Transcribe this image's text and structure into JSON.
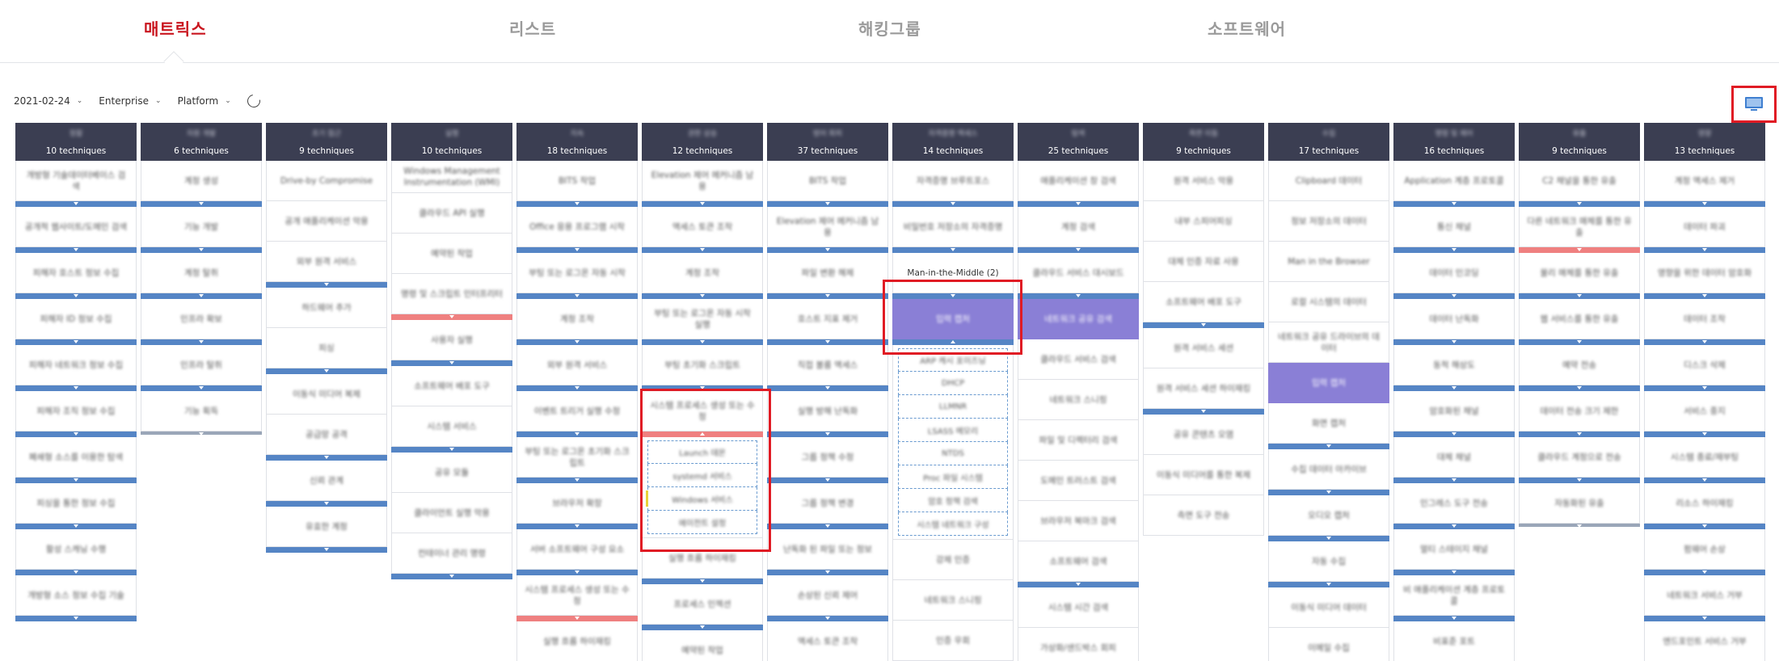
{
  "nav": {
    "tabs": [
      {
        "label": "매트릭스",
        "active": true
      },
      {
        "label": "리스트",
        "active": false
      },
      {
        "label": "해킹그룹",
        "active": false
      },
      {
        "label": "소프트웨어",
        "active": false
      }
    ]
  },
  "filters": {
    "date": "2021-02-24",
    "domain": "Enterprise",
    "platform": "Platform"
  },
  "colors": {
    "accent": "#c9151e",
    "header": "#3b3e52",
    "bar": "#5585c5",
    "bar_red": "#ef8080",
    "selected": "#8a7fd6",
    "highlight": "#e01b24"
  },
  "icons": {
    "view_toggle": "monitor-icon",
    "refresh": "refresh-icon",
    "chevron": "chevron-down-icon"
  },
  "columns": [
    {
      "tactic": "정찰",
      "count": "10 techniques",
      "cells": [
        {
          "t": "개방형 기술데이터베이스 검색",
          "bar": "blue"
        },
        {
          "t": "공개적 웹사이트/도메인 검색",
          "bar": "blue"
        },
        {
          "t": "피해자 호스트 정보 수집",
          "bar": "blue"
        },
        {
          "t": "피해자 ID 정보 수집",
          "bar": "blue"
        },
        {
          "t": "피해자 네트워크 정보 수집",
          "bar": "blue"
        },
        {
          "t": "피해자 조직 정보 수집",
          "bar": "blue"
        },
        {
          "t": "폐쇄형 소스를 이용한 탐색",
          "bar": "blue"
        },
        {
          "t": "피싱을 통한 정보 수집",
          "bar": "blue"
        },
        {
          "t": "활성 스캐닝 수행",
          "bar": "blue"
        },
        {
          "t": "개방형 소스 정보 수집 기술",
          "bar": "blue"
        }
      ]
    },
    {
      "tactic": "자원 개발",
      "count": "6 techniques",
      "cells": [
        {
          "t": "계정 생성",
          "bar": "blue"
        },
        {
          "t": "기능 개발",
          "bar": "blue"
        },
        {
          "t": "계정 탈취",
          "bar": "blue"
        },
        {
          "t": "인프라 확보",
          "bar": "blue"
        },
        {
          "t": "인프라 탈취",
          "bar": "blue"
        },
        {
          "t": "기능 획득",
          "bar": "gray"
        }
      ]
    },
    {
      "tactic": "초기 접근",
      "count": "9 techniques",
      "cells": [
        {
          "t": "Drive-by Compromise",
          "bar": "none"
        },
        {
          "t": "공개 애플리케이션 악용",
          "bar": "none"
        },
        {
          "t": "외부 원격 서비스",
          "bar": "blue"
        },
        {
          "t": "하드웨어 추가",
          "bar": "none"
        },
        {
          "t": "피싱",
          "bar": "blue"
        },
        {
          "t": "이동식 미디어 복제",
          "bar": "none"
        },
        {
          "t": "공급망 공격",
          "bar": "blue"
        },
        {
          "t": "신뢰 관계",
          "bar": "blue"
        },
        {
          "t": "유효한 계정",
          "bar": "blue"
        }
      ]
    },
    {
      "tactic": "실행",
      "count": "10 techniques",
      "cells": [
        {
          "t": "Windows Management Instrumentation (WMI)",
          "bar": "none"
        },
        {
          "t": "클라우드 API 실행",
          "bar": "none"
        },
        {
          "t": "예약된 작업",
          "bar": "none"
        },
        {
          "t": "명령 및 스크립트 인터프리터",
          "bar": "red"
        },
        {
          "t": "사용자 실행",
          "bar": "blue"
        },
        {
          "t": "소프트웨어 배포 도구",
          "bar": "none"
        },
        {
          "t": "시스템 서비스",
          "bar": "blue"
        },
        {
          "t": "공유 모듈",
          "bar": "none"
        },
        {
          "t": "클라이언트 실행 악용",
          "bar": "none"
        },
        {
          "t": "컨테이너 관리 명령",
          "bar": "blue"
        }
      ]
    },
    {
      "tactic": "지속",
      "count": "18 techniques",
      "cells": [
        {
          "t": "BITS 작업",
          "bar": "blue"
        },
        {
          "t": "Office 응용 프로그램 시작",
          "bar": "blue"
        },
        {
          "t": "부팅 또는 로그온 자동 시작",
          "bar": "blue"
        },
        {
          "t": "계정 조작",
          "bar": "blue"
        },
        {
          "t": "외부 원격 서비스",
          "bar": "blue"
        },
        {
          "t": "이벤트 트리거 실행 수정",
          "bar": "blue"
        },
        {
          "t": "부팅 또는 로그온 초기화 스크립트",
          "bar": "blue"
        },
        {
          "t": "브라우저 확장",
          "bar": "blue"
        },
        {
          "t": "서버 소프트웨어 구성 요소",
          "bar": "blue"
        },
        {
          "t": "시스템 프로세스 생성 또는 수정",
          "bar": "red"
        },
        {
          "t": "실행 흐름 하이재킹",
          "bar": "none"
        }
      ]
    },
    {
      "tactic": "권한 상승",
      "count": "12 techniques",
      "cells": [
        {
          "t": "Elevation 제어 메커니즘 남용",
          "bar": "blue"
        },
        {
          "t": "액세스 토큰 조작",
          "bar": "blue"
        },
        {
          "t": "계정 조작",
          "bar": "blue"
        },
        {
          "t": "부팅 또는 로그온 자동 시작 실행",
          "bar": "blue"
        },
        {
          "t": "부팅 초기화 스크립트",
          "bar": "blue"
        },
        {
          "t": "시스템 프로세스 생성 또는 수정",
          "bar": "red-up"
        },
        {
          "t": "실행 흐름 하이재킹",
          "bar": "blue"
        },
        {
          "t": "프로세스 인젝션",
          "bar": "blue"
        },
        {
          "t": "예약된 작업",
          "bar": "none"
        }
      ],
      "sub": [
        "Launch 데몬",
        "systemd 서비스",
        "Windows 서비스",
        "에이전트 설정"
      ]
    },
    {
      "tactic": "방어 회피",
      "count": "37 techniques",
      "cells": [
        {
          "t": "BITS 작업",
          "bar": "blue"
        },
        {
          "t": "Elevation 제어 메커니즘 남용",
          "bar": "blue"
        },
        {
          "t": "파일 변환 해제",
          "bar": "blue"
        },
        {
          "t": "호스트 지표 제거",
          "bar": "blue"
        },
        {
          "t": "직접 볼륨 액세스",
          "bar": "blue"
        },
        {
          "t": "실행 방해 난독화",
          "bar": "blue"
        },
        {
          "t": "그룹 정책 수정",
          "bar": "blue"
        },
        {
          "t": "그룹 정책 변경",
          "bar": "blue"
        },
        {
          "t": "난독화 된 파일 또는 정보",
          "bar": "blue"
        },
        {
          "t": "손상된 신뢰 제어",
          "bar": "blue"
        },
        {
          "t": "액세스 토큰 조작",
          "bar": "blue"
        }
      ]
    },
    {
      "tactic": "자격증명 액세스",
      "count": "14 techniques",
      "cells": [
        {
          "t": "자격증명 브루트포스",
          "bar": "blue"
        },
        {
          "t": "비밀번호 저장소의 자격증명",
          "bar": "blue"
        },
        {
          "t": "Man-in-the-Middle (2)",
          "bar": "blue",
          "clear": true
        },
        {
          "t": "입력 캡처",
          "bar": "up",
          "purple": true
        }
      ],
      "sub": [
        "ARP 캐시 포이즈닝",
        "DHCP",
        "LLMNR",
        "LSASS 메모리",
        "NTDS",
        "Proc 파일 시스템",
        "암호 정책 검색",
        "시스템 네트워크 구성"
      ],
      "after": [
        "강제 인증",
        "네트워크 스니핑",
        "인증 우회"
      ]
    },
    {
      "tactic": "탐색",
      "count": "25 techniques",
      "cells": [
        {
          "t": "애플리케이션 창 검색",
          "bar": "blue"
        },
        {
          "t": "계정 검색",
          "bar": "blue"
        },
        {
          "t": "클라우드 서비스 대시보드",
          "bar": "blue"
        },
        {
          "t": "네트워크 공유 검색",
          "bar": "purple"
        },
        {
          "t": "클라우드 서비스 검색",
          "bar": "none"
        },
        {
          "t": "네트워크 스니핑",
          "bar": "none"
        },
        {
          "t": "파일 및 디렉터리 검색",
          "bar": "none"
        },
        {
          "t": "도메인 트러스트 검색",
          "bar": "none"
        },
        {
          "t": "브라우저 북마크 검색",
          "bar": "none"
        },
        {
          "t": "소프트웨어 검색",
          "bar": "blue"
        },
        {
          "t": "시스템 시간 검색",
          "bar": "none"
        },
        {
          "t": "가상화/샌드박스 회피",
          "bar": "none"
        }
      ]
    },
    {
      "tactic": "측면 이동",
      "count": "9 techniques",
      "cells": [
        {
          "t": "원격 서비스 악용",
          "bar": "none"
        },
        {
          "t": "내부 스피어피싱",
          "bar": "none"
        },
        {
          "t": "대체 인증 자료 사용",
          "bar": "none"
        },
        {
          "t": "소프트웨어 배포 도구",
          "bar": "blue"
        },
        {
          "t": "원격 서비스 세션",
          "bar": "none"
        },
        {
          "t": "원격 서비스 세션 하이재킹",
          "bar": "blue"
        },
        {
          "t": "공유 콘텐츠 오염",
          "bar": "none"
        },
        {
          "t": "이동식 미디어를 통한 복제",
          "bar": "none"
        },
        {
          "t": "측면 도구 전송",
          "bar": "none"
        }
      ]
    },
    {
      "tactic": "수집",
      "count": "17 techniques",
      "cells": [
        {
          "t": "Clipboard 데이터",
          "bar": "none"
        },
        {
          "t": "정보 저장소의 데이터",
          "bar": "none"
        },
        {
          "t": "Man in the Browser",
          "bar": "none"
        },
        {
          "t": "로컬 시스템의 데이터",
          "bar": "none"
        },
        {
          "t": "네트워크 공유 드라이브의 데이터",
          "bar": "none"
        },
        {
          "t": "입력 캡처",
          "bar": "purple"
        },
        {
          "t": "화면 캡처",
          "bar": "blue"
        },
        {
          "t": "수집 데이터 아카이브",
          "bar": "blue"
        },
        {
          "t": "오디오 캡처",
          "bar": "blue"
        },
        {
          "t": "자동 수집",
          "bar": "blue"
        },
        {
          "t": "이동식 미디어 데이터",
          "bar": "none"
        },
        {
          "t": "이메일 수집",
          "bar": "none"
        }
      ]
    },
    {
      "tactic": "명령 및 제어",
      "count": "16 techniques",
      "cells": [
        {
          "t": "Application 계층 프로토콜",
          "bar": "blue"
        },
        {
          "t": "통신 채널",
          "bar": "blue"
        },
        {
          "t": "데이터 인코딩",
          "bar": "blue"
        },
        {
          "t": "데이터 난독화",
          "bar": "blue"
        },
        {
          "t": "동적 해상도",
          "bar": "blue"
        },
        {
          "t": "암호화된 채널",
          "bar": "blue"
        },
        {
          "t": "대체 채널",
          "bar": "blue"
        },
        {
          "t": "인그레스 도구 전송",
          "bar": "blue"
        },
        {
          "t": "멀티 스테이지 채널",
          "bar": "blue"
        },
        {
          "t": "비 애플리케이션 계층 프로토콜",
          "bar": "blue"
        },
        {
          "t": "비표준 포트",
          "bar": "blue"
        }
      ]
    },
    {
      "tactic": "유출",
      "count": "9 techniques",
      "cells": [
        {
          "t": "C2 채널을 통한 유출",
          "bar": "blue"
        },
        {
          "t": "다른 네트워크 매체를 통한 유출",
          "bar": "red"
        },
        {
          "t": "물리 매체를 통한 유출",
          "bar": "blue"
        },
        {
          "t": "웹 서비스를 통한 유출",
          "bar": "blue"
        },
        {
          "t": "예약 전송",
          "bar": "blue"
        },
        {
          "t": "데이터 전송 크기 제한",
          "bar": "blue"
        },
        {
          "t": "클라우드 계정으로 전송",
          "bar": "blue"
        },
        {
          "t": "자동화된 유출",
          "bar": "gray"
        }
      ]
    },
    {
      "tactic": "영향",
      "count": "13 techniques",
      "cells": [
        {
          "t": "계정 액세스 제거",
          "bar": "blue"
        },
        {
          "t": "데이터 파괴",
          "bar": "blue"
        },
        {
          "t": "영향을 위한 데이터 암호화",
          "bar": "blue"
        },
        {
          "t": "데이터 조작",
          "bar": "blue"
        },
        {
          "t": "디스크 삭제",
          "bar": "blue"
        },
        {
          "t": "서비스 중지",
          "bar": "blue"
        },
        {
          "t": "시스템 종료/재부팅",
          "bar": "blue"
        },
        {
          "t": "리소스 하이재킹",
          "bar": "blue"
        },
        {
          "t": "펌웨어 손상",
          "bar": "blue"
        },
        {
          "t": "네트워크 서비스 거부",
          "bar": "blue"
        },
        {
          "t": "엔드포인트 서비스 거부",
          "bar": "blue"
        }
      ]
    }
  ]
}
